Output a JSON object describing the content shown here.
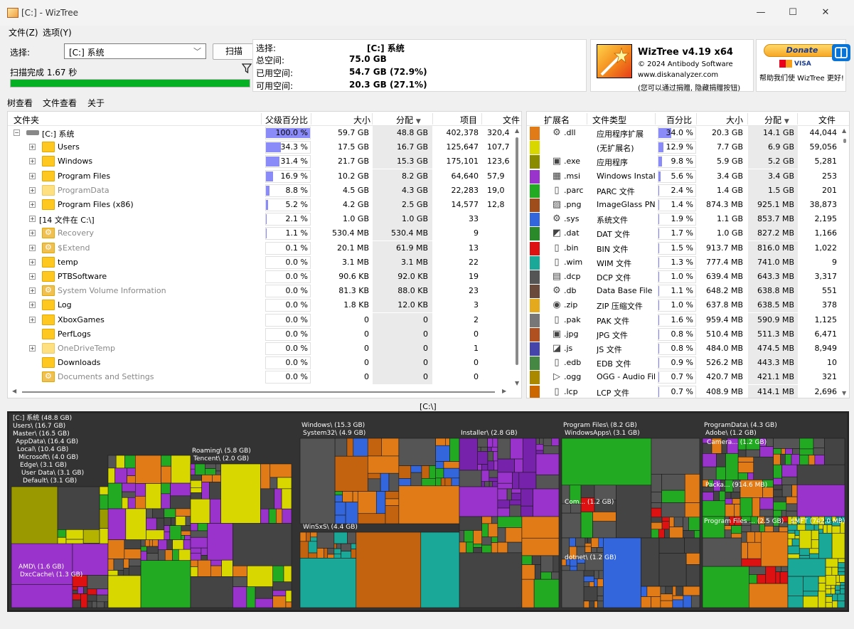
{
  "window": {
    "title": "[C:]  - WizTree"
  },
  "menu": {
    "file": "文件(Z)",
    "options": "选项(Y)"
  },
  "scan": {
    "select_label": "选择:",
    "drive": "[C:] 系统",
    "scan_button": "扫描",
    "status": "扫描完成 1.67 秒",
    "progress": 1.0
  },
  "stats": {
    "select": {
      "label": "选择:",
      "value": "[C:]  系统"
    },
    "total": {
      "label": "总空间:",
      "value": "75.0 GB"
    },
    "used": {
      "label": "已用空间:",
      "value": "54.7 GB  (72.9%)"
    },
    "free": {
      "label": "可用空间:",
      "value": "20.3 GB  (27.1%)"
    }
  },
  "about": {
    "name": "WizTree v4.19 x64",
    "copyright": "© 2024 Antibody Software",
    "website": "www.diskanalyzer.com",
    "note": "(您可以通过捐赠, 隐藏捐赠按钮)",
    "donate": "Donate",
    "cards": "VISA",
    "help_us": "帮助我们使 WizTree 更好!"
  },
  "tabs": [
    "树查看",
    "文件查看",
    "关于"
  ],
  "folder_table": {
    "headers": {
      "folder": "文件夹",
      "parent_pct": "父级百分比",
      "size": "大小",
      "alloc": "分配",
      "items": "项目",
      "files": "文件"
    },
    "rows": [
      {
        "name": "[C:] 系统",
        "pct": "100.0 %",
        "pctv": 1.0,
        "size": "59.7 GB",
        "alloc": "48.8 GB",
        "items": "402,378",
        "files": "320,4",
        "icon": "drive",
        "dim": false,
        "expander": "⊟"
      },
      {
        "name": "Users",
        "pct": "34.3 %",
        "pctv": 0.343,
        "size": "17.5 GB",
        "alloc": "16.7 GB",
        "items": "125,647",
        "files": "107,7",
        "icon": "folder",
        "dim": false,
        "expander": "+"
      },
      {
        "name": "Windows",
        "pct": "31.4 %",
        "pctv": 0.314,
        "size": "21.7 GB",
        "alloc": "15.3 GB",
        "items": "175,101",
        "files": "123,6",
        "icon": "folder",
        "dim": false,
        "expander": "+"
      },
      {
        "name": "Program Files",
        "pct": "16.9 %",
        "pctv": 0.169,
        "size": "10.2 GB",
        "alloc": "8.2 GB",
        "items": "64,640",
        "files": "57,9",
        "icon": "folder",
        "dim": false,
        "expander": "+"
      },
      {
        "name": "ProgramData",
        "pct": "8.8 %",
        "pctv": 0.088,
        "size": "4.5 GB",
        "alloc": "4.3 GB",
        "items": "22,283",
        "files": "19,0",
        "icon": "folder",
        "dim": true,
        "expander": "+"
      },
      {
        "name": "Program Files (x86)",
        "pct": "5.2 %",
        "pctv": 0.052,
        "size": "4.2 GB",
        "alloc": "2.5 GB",
        "items": "14,577",
        "files": "12,8",
        "icon": "folder",
        "dim": false,
        "expander": "+"
      },
      {
        "name": "[14 文件在 C:\\]",
        "pct": "2.1 %",
        "pctv": 0.021,
        "size": "1.0 GB",
        "alloc": "1.0 GB",
        "items": "33",
        "files": "",
        "icon": "none",
        "dim": false,
        "expander": "+"
      },
      {
        "name": "Recovery",
        "pct": "1.1 %",
        "pctv": 0.011,
        "size": "530.4 MB",
        "alloc": "530.4 MB",
        "items": "9",
        "files": "",
        "icon": "sys",
        "dim": true,
        "expander": "+"
      },
      {
        "name": "$Extend",
        "pct": "0.1 %",
        "pctv": 0.001,
        "size": "20.1 MB",
        "alloc": "61.9 MB",
        "items": "13",
        "files": "",
        "icon": "sys",
        "dim": true,
        "expander": "+"
      },
      {
        "name": "temp",
        "pct": "0.0 %",
        "pctv": 0,
        "size": "3.1 MB",
        "alloc": "3.1 MB",
        "items": "22",
        "files": "",
        "icon": "folder",
        "dim": false,
        "expander": "+"
      },
      {
        "name": "PTBSoftware",
        "pct": "0.0 %",
        "pctv": 0,
        "size": "90.6 KB",
        "alloc": "92.0 KB",
        "items": "19",
        "files": "",
        "icon": "folder",
        "dim": false,
        "expander": "+"
      },
      {
        "name": "System Volume Information",
        "pct": "0.0 %",
        "pctv": 0,
        "size": "81.3 KB",
        "alloc": "88.0 KB",
        "items": "23",
        "files": "",
        "icon": "sys",
        "dim": true,
        "expander": "+"
      },
      {
        "name": "Log",
        "pct": "0.0 %",
        "pctv": 0,
        "size": "1.8 KB",
        "alloc": "12.0 KB",
        "items": "3",
        "files": "",
        "icon": "folder",
        "dim": false,
        "expander": "+"
      },
      {
        "name": "XboxGames",
        "pct": "0.0 %",
        "pctv": 0,
        "size": "0",
        "alloc": "0",
        "items": "2",
        "files": "",
        "icon": "folder",
        "dim": false,
        "expander": "+"
      },
      {
        "name": "PerfLogs",
        "pct": "0.0 %",
        "pctv": 0,
        "size": "0",
        "alloc": "0",
        "items": "0",
        "files": "",
        "icon": "folder",
        "dim": false,
        "expander": ""
      },
      {
        "name": "OneDriveTemp",
        "pct": "0.0 %",
        "pctv": 0,
        "size": "0",
        "alloc": "0",
        "items": "1",
        "files": "",
        "icon": "folder",
        "dim": true,
        "expander": "+"
      },
      {
        "name": "Downloads",
        "pct": "0.0 %",
        "pctv": 0,
        "size": "0",
        "alloc": "0",
        "items": "0",
        "files": "",
        "icon": "folder",
        "dim": false,
        "expander": ""
      },
      {
        "name": "Documents and Settings",
        "pct": "0.0 %",
        "pctv": 0,
        "size": "0",
        "alloc": "0",
        "items": "0",
        "files": "",
        "icon": "sys",
        "dim": true,
        "expander": ""
      }
    ]
  },
  "ext_table": {
    "headers": {
      "ext": "扩展名",
      "type": "文件类型",
      "pct": "百分比",
      "size": "大小",
      "alloc": "分配",
      "files": "文件"
    },
    "rows": [
      {
        "color": "#e07b17",
        "icon": "gear",
        "ext": ".dll",
        "type": "应用程序扩展",
        "pct": "34.0 %",
        "pctv": 0.34,
        "size": "20.3 GB",
        "alloc": "14.1 GB",
        "files": "44,044"
      },
      {
        "color": "#d8d800",
        "icon": "none",
        "ext": "",
        "type": "(无扩展名)",
        "pct": "12.9 %",
        "pctv": 0.129,
        "size": "7.7 GB",
        "alloc": "6.9 GB",
        "files": "59,056"
      },
      {
        "color": "#8b8b00",
        "icon": "exe",
        "ext": ".exe",
        "type": "应用程序",
        "pct": "9.8 %",
        "pctv": 0.098,
        "size": "5.9 GB",
        "alloc": "5.2 GB",
        "files": "5,281"
      },
      {
        "color": "#9933cc",
        "icon": "msi",
        "ext": ".msi",
        "type": "Windows Installe",
        "pct": "5.6 %",
        "pctv": 0.056,
        "size": "3.4 GB",
        "alloc": "3.4 GB",
        "files": "253"
      },
      {
        "color": "#22aa22",
        "icon": "doc",
        "ext": ".parc",
        "type": "PARC 文件",
        "pct": "2.4 %",
        "pctv": 0.024,
        "size": "1.4 GB",
        "alloc": "1.5 GB",
        "files": "201"
      },
      {
        "color": "#a04d1c",
        "icon": "img",
        "ext": ".png",
        "type": "ImageGlass PNG",
        "pct": "1.4 %",
        "pctv": 0.014,
        "size": "874.3 MB",
        "alloc": "925.1 MB",
        "files": "38,873"
      },
      {
        "color": "#3366dd",
        "icon": "gear",
        "ext": ".sys",
        "type": "系统文件",
        "pct": "1.9 %",
        "pctv": 0.019,
        "size": "1.1 GB",
        "alloc": "853.7 MB",
        "files": "2,195"
      },
      {
        "color": "#2a8a2a",
        "icon": "dat",
        "ext": ".dat",
        "type": "DAT 文件",
        "pct": "1.7 %",
        "pctv": 0.017,
        "size": "1.0 GB",
        "alloc": "827.2 MB",
        "files": "1,166"
      },
      {
        "color": "#dd1111",
        "icon": "doc",
        "ext": ".bin",
        "type": "BIN 文件",
        "pct": "1.5 %",
        "pctv": 0.015,
        "size": "913.7 MB",
        "alloc": "816.0 MB",
        "files": "1,022"
      },
      {
        "color": "#1aa899",
        "icon": "doc",
        "ext": ".wim",
        "type": "WIM 文件",
        "pct": "1.3 %",
        "pctv": 0.013,
        "size": "777.4 MB",
        "alloc": "741.0 MB",
        "files": "9"
      },
      {
        "color": "#555555",
        "icon": "dcp",
        "ext": ".dcp",
        "type": "DCP 文件",
        "pct": "1.0 %",
        "pctv": 0.01,
        "size": "639.4 MB",
        "alloc": "643.3 MB",
        "files": "3,317"
      },
      {
        "color": "#6a4a3a",
        "icon": "gear",
        "ext": ".db",
        "type": "Data Base File",
        "pct": "1.1 %",
        "pctv": 0.011,
        "size": "648.2 MB",
        "alloc": "638.8 MB",
        "files": "551"
      },
      {
        "color": "#e4a91c",
        "icon": "zip",
        "ext": ".zip",
        "type": "ZIP 压缩文件",
        "pct": "1.0 %",
        "pctv": 0.01,
        "size": "637.8 MB",
        "alloc": "638.5 MB",
        "files": "378"
      },
      {
        "color": "#777777",
        "icon": "doc",
        "ext": ".pak",
        "type": "PAK 文件",
        "pct": "1.6 %",
        "pctv": 0.016,
        "size": "959.4 MB",
        "alloc": "590.9 MB",
        "files": "1,125"
      },
      {
        "color": "#b05020",
        "icon": "jpg",
        "ext": ".jpg",
        "type": "JPG 文件",
        "pct": "0.8 %",
        "pctv": 0.008,
        "size": "510.4 MB",
        "alloc": "511.3 MB",
        "files": "6,471"
      },
      {
        "color": "#4444aa",
        "icon": "js",
        "ext": ".js",
        "type": "JS 文件",
        "pct": "0.8 %",
        "pctv": 0.008,
        "size": "484.0 MB",
        "alloc": "474.5 MB",
        "files": "8,949"
      },
      {
        "color": "#448844",
        "icon": "doc",
        "ext": ".edb",
        "type": "EDB 文件",
        "pct": "0.9 %",
        "pctv": 0.009,
        "size": "526.2 MB",
        "alloc": "443.3 MB",
        "files": "10"
      },
      {
        "color": "#aa8800",
        "icon": "ogg",
        "ext": ".ogg",
        "type": "OGG - Audio File",
        "pct": "0.7 %",
        "pctv": 0.007,
        "size": "420.7 MB",
        "alloc": "421.1 MB",
        "files": "321"
      },
      {
        "color": "#cc6600",
        "icon": "doc",
        "ext": ".lcp",
        "type": "LCP 文件",
        "pct": "0.7 %",
        "pctv": 0.007,
        "size": "408.9 MB",
        "alloc": "414.1 MB",
        "files": "2,696"
      }
    ]
  },
  "treemap": {
    "path": "[C:\\]",
    "labels": [
      "[C:] 系统  (48.8 GB)",
      "Users\\ (16.7 GB)",
      "Master\\ (16.5 GB)",
      "AppData\\ (16.4 GB)",
      "Local\\ (10.4 GB)",
      "Microsoft\\ (4.0 GB)",
      "Edge\\ (3.1 GB)",
      "User Data\\ (3.1 GB)",
      "Default\\ (3.1 GB)",
      "Roaming\\ (5.8 GB)",
      "Tencent\\ (2.0 GB)",
      "AMD\\ (1.6 GB)",
      "DxcCache\\ (1.3 GB)",
      "Windows\\ (15.3 GB)",
      "System32\\ (4.9 GB)",
      "Installer\\ (2.8 GB)",
      "WinSxS\\ (4.4 GB)",
      "Program Files\\ (8.2 GB)",
      "WindowsApps\\ (3.1 GB)",
      "Com... (1.2 GB)",
      "dotnet\\ (1.2 GB)",
      "ProgramData\\ (4.3 GB)",
      "Adobe\\ (1.2 GB)",
      "Camera... (1.2 GB)",
      "Packa... (914.6 MB)",
      "Program Files ... (2.5 GB)",
      "$MFT (742.0 MB)"
    ]
  }
}
